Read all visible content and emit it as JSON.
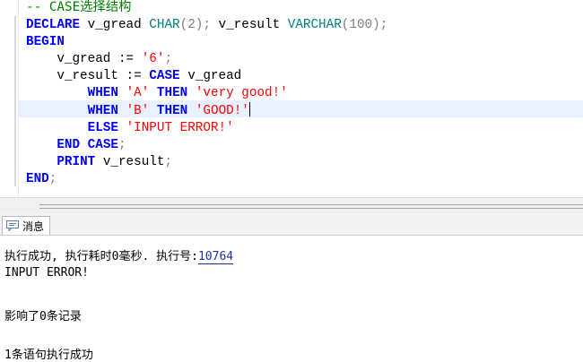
{
  "editor": {
    "comment": "-- CASE选择结构",
    "lines": {
      "declare_kw": "DECLARE",
      "v_gread_decl": " v_gread ",
      "char_type": "CHAR",
      "char_len": "(2);",
      "v_result_decl": " v_result ",
      "varchar_type": "VARCHAR",
      "varchar_len": "(100);",
      "begin_kw": "BEGIN",
      "assign_gread": "    v_gread := ",
      "gread_value": "'6'",
      "semicolon": ";",
      "assign_result": "    v_result := ",
      "case_kw": "CASE",
      "case_expr": " v_gread",
      "when1_indent": "        ",
      "when_kw": "WHEN",
      "when1_val": "'A'",
      "then_kw": "THEN",
      "when1_result": "'very good!'",
      "when2_val": "'B'",
      "when2_result": "'GOOD!'",
      "else_kw": "ELSE",
      "else_result": "'INPUT ERROR!'",
      "end_kw": "END",
      "print_kw": "PRINT",
      "print_arg": " v_result",
      "end_final": "END"
    }
  },
  "messages_tab": {
    "label": "消息"
  },
  "messages": {
    "exec_prefix": "执行成功, 执行耗时0毫秒. 执行号:",
    "exec_id": "10764",
    "output": "INPUT ERROR!",
    "affected": "影响了0条记录",
    "summary": "1条语句执行成功"
  },
  "colors": {
    "keyword": "#0000ff",
    "type": "#008080",
    "string": "#ff0000",
    "comment": "#008000",
    "current_line": "#e8f2fe"
  }
}
